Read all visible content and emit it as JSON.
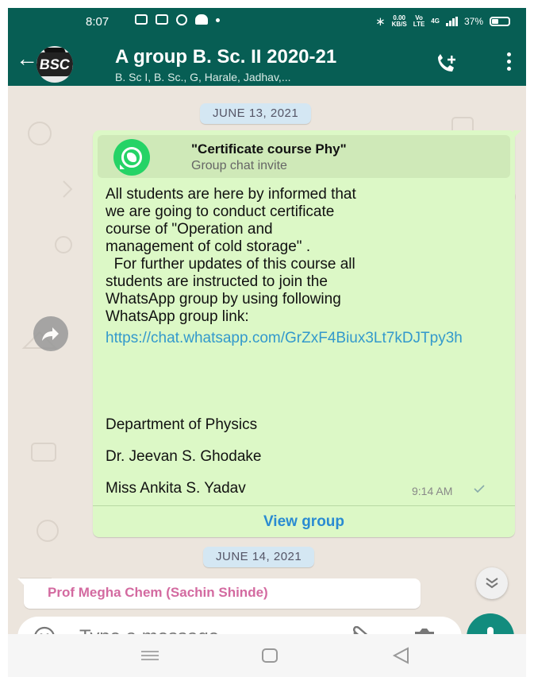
{
  "status_bar": {
    "time": "8:07",
    "net_speed": "0.00\nKB/S",
    "volte": "Vo\nLTE",
    "network": "4G",
    "battery": "37%"
  },
  "header": {
    "back_icon": "arrow-left-icon",
    "avatar_text": "BSC",
    "title": "A group B. Sc. II 2020-21",
    "subtitle": "B. Sc I, B. Sc., G, Harale, Jadhav,...",
    "call_icon": "add-call-icon",
    "menu_icon": "more-vertical-icon"
  },
  "chat": {
    "date_1": "JUNE 13, 2021",
    "invite": {
      "title": "\"Certificate course Phy\"",
      "subtitle": "Group chat invite",
      "icon": "whatsapp-icon"
    },
    "message_text": "All students are here by informed that\nwe are going to conduct certificate\ncourse of \"Operation and\nmanagement of cold storage\" .\n  For further updates of this course all\nstudents are instructed to join the\nWhatsApp group by using following\nWhatsApp group link:",
    "message_link": "https://chat.whatsapp.com/GrZxF4Biux3Lt7kDJTpy3h",
    "signature_1": "Department of Physics",
    "signature_2": "Dr. Jeevan S. Ghodake",
    "signature_3": "Miss Ankita S. Yadav",
    "message_time": "9:14 AM",
    "view_group_label": "View group",
    "date_2": "JUNE 14, 2021",
    "next_sender": "Prof Megha Chem (Sachin Shinde)"
  },
  "input_bar": {
    "placeholder": "Type a message",
    "emoji_icon": "emoji-icon",
    "attach_icon": "paperclip-icon",
    "camera_icon": "camera-icon",
    "mic_icon": "microphone-icon"
  },
  "colors": {
    "header": "#075e54",
    "bubble_out": "#dcf8c6",
    "link": "#3399cc",
    "mic_button": "#128c7e",
    "sender_name": "#d36aa0"
  }
}
